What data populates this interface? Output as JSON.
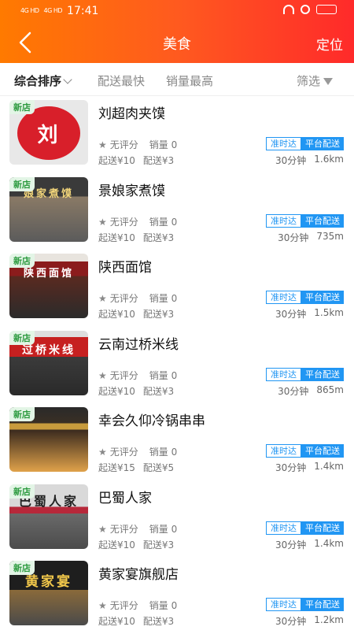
{
  "status": {
    "signal1": "4G HD",
    "signal2": "4G HD",
    "time": "17:41",
    "battery": ""
  },
  "nav": {
    "title": "美食",
    "locate": "定位"
  },
  "filters": [
    "综合排序",
    "配送最快",
    "销量最高",
    "筛选"
  ],
  "labels": {
    "new": "新店",
    "rating": "无评分",
    "on_time": "准时达",
    "platform": "平台配送"
  },
  "shops": [
    {
      "name": "刘超肉夹馍",
      "sales": "销量 0",
      "min_order": "起送¥10",
      "delivery_fee": "配送¥3",
      "time": "30分钟",
      "distance": "1.6km",
      "sign": "刘"
    },
    {
      "name": "景娘家煮馍",
      "sales": "销量 0",
      "min_order": "起送¥10",
      "delivery_fee": "配送¥3",
      "time": "30分钟",
      "distance": "735m",
      "sign": "娘家煮馍"
    },
    {
      "name": "陕西面馆",
      "sales": "销量 0",
      "min_order": "起送¥10",
      "delivery_fee": "配送¥3",
      "time": "30分钟",
      "distance": "1.5km",
      "sign": "陕西面馆"
    },
    {
      "name": "云南过桥米线",
      "sales": "销量 0",
      "min_order": "起送¥10",
      "delivery_fee": "配送¥3",
      "time": "30分钟",
      "distance": "865m",
      "sign": "过桥米线"
    },
    {
      "name": "幸会久仰冷锅串串",
      "sales": "销量 0",
      "min_order": "起送¥15",
      "delivery_fee": "配送¥5",
      "time": "30分钟",
      "distance": "1.4km",
      "sign": ""
    },
    {
      "name": "巴蜀人家",
      "sales": "销量 0",
      "min_order": "起送¥10",
      "delivery_fee": "配送¥3",
      "time": "30分钟",
      "distance": "1.4km",
      "sign": "巴蜀人家"
    },
    {
      "name": "黄家宴旗舰店",
      "sales": "销量 0",
      "min_order": "起送¥10",
      "delivery_fee": "配送¥3",
      "time": "30分钟",
      "distance": "1.2km",
      "sign": "黄家宴"
    }
  ],
  "colors": {
    "header_start": "#ff7a00",
    "header_end": "#ff2a2a",
    "badge_blue": "#2196f3",
    "new_green": "#2b9a3e"
  }
}
